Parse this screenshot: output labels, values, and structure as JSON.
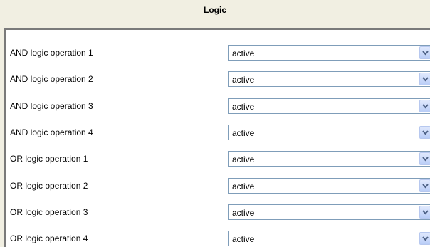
{
  "window": {
    "title": "Logic"
  },
  "rows": [
    {
      "label": "AND logic operation 1",
      "value": "active"
    },
    {
      "label": "AND logic operation 2",
      "value": "active"
    },
    {
      "label": "AND logic operation 3",
      "value": "active"
    },
    {
      "label": "AND logic operation 4",
      "value": "active"
    },
    {
      "label": "OR logic operation 1",
      "value": "active"
    },
    {
      "label": "OR logic operation 2",
      "value": "active"
    },
    {
      "label": "OR logic operation 3",
      "value": "active"
    },
    {
      "label": "OR logic operation 4",
      "value": "active"
    }
  ],
  "icons": {
    "dropdown": "chevron-down-icon"
  },
  "colors": {
    "panel_background": "#ffffff",
    "window_background": "#f1efe2",
    "combo_border": "#7f9db9",
    "chevron": "#4d6185"
  }
}
